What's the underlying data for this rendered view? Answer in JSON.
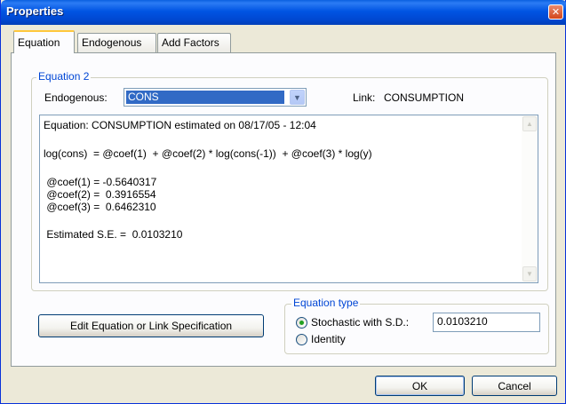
{
  "window": {
    "title": "Properties",
    "close_glyph": "✕"
  },
  "tabs": [
    {
      "label": "Equation",
      "active": true
    },
    {
      "label": "Endogenous",
      "active": false
    },
    {
      "label": "Add Factors",
      "active": false
    }
  ],
  "equation_group": {
    "legend": "Equation 2",
    "endogenous_label": "Endogenous:",
    "endogenous_value": "CONS",
    "link_label": "Link:",
    "link_value": "CONSUMPTION"
  },
  "equation_text": {
    "lines": [
      "Equation: CONSUMPTION estimated on 08/17/05 - 12:04",
      "log(cons)  = @coef(1)  + @coef(2) * log(cons(-1))  + @coef(3) * log(y)",
      " @coef(1) = -0.5640317",
      " @coef(2) =  0.3916554",
      " @coef(3) =  0.6462310",
      " Estimated S.E. =  0.0103210"
    ]
  },
  "edit_button_label": "Edit Equation or Link Specification",
  "equation_type": {
    "legend": "Equation type",
    "options": [
      {
        "label": "Stochastic with S.D.:",
        "selected": true
      },
      {
        "label": "Identity",
        "selected": false
      }
    ],
    "sd_value": "0.0103210"
  },
  "footer": {
    "ok_label": "OK",
    "cancel_label": "Cancel"
  },
  "colors": {
    "titlebar": "#0054e3",
    "selection": "#316ac5",
    "group_legend": "#0046d5",
    "radio_dot": "#21a121"
  },
  "icons": {
    "close": "close-icon",
    "dropdown": "chevron-down-icon",
    "scroll_up": "scroll-up-icon",
    "scroll_down": "scroll-down-icon"
  }
}
